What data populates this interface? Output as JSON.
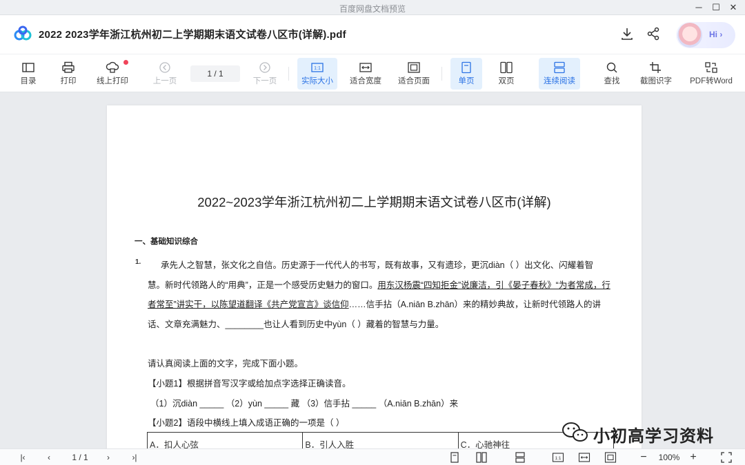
{
  "window": {
    "title": "百度网盘文档预览"
  },
  "header": {
    "doc_title": "2022  2023学年浙江杭州初二上学期期末语文试卷八区市(详解).pdf",
    "avatar_text": "Hi ›"
  },
  "toolbar": {
    "toc": "目录",
    "print": "打印",
    "online_print": "线上打印",
    "prev": "上一页",
    "page_indicator": "1  /  1",
    "next": "下一页",
    "actual_size": "实际大小",
    "fit_width": "适合宽度",
    "fit_page": "适合页面",
    "single": "单页",
    "double": "双页",
    "continuous": "连续阅读",
    "find": "查找",
    "ocr": "截图识字",
    "pdf2word": "PDF转Word"
  },
  "document": {
    "title": "2022~2023学年浙江杭州初二上学期期末语文试卷八区市(详解)",
    "section1": "一、基础知识综合",
    "q_number": "1.",
    "p1": "承先人之智慧，张文化之自信。历史源于一代代人的书写，既有故事，又有遗珍，更沉diàn（    ）出文化、闪耀着智",
    "p2_a": "慧。新时代领路人的“用典”，正是一个感受历史魅力的窗口。",
    "p2_b": "用东汉杨震“四知拒金”说廉洁，引《晏子春秋》“为者常成，行",
    "p3_a": "者常至”讲实干，以陈望道翻译《共产党宣言》谈信仰",
    "p3_b": "……信手拈（A.niān B.zhān）来的精妙典故，让新时代领路人的讲",
    "p4": "话、文章充满魅力、________也让人看到历史中yùn（    ）藏着的智慧与力量。",
    "instr": "请认真阅读上面的文字，完成下面小题。",
    "sub1": "【小题1】根据拼音写汉字或给加点字选择正确读音。",
    "sub1_line": "（1）沉diàn _____        （2）yùn _____ 藏        （3）信手拈 _____    （A.niān     B.zhān）来",
    "sub2": "【小题2】语段中横线上填入成语正确的一项是（     ）",
    "options": [
      "A．扣人心弦",
      "B．引人入胜",
      "C．心驰神往"
    ],
    "watermark": "小初高学习资料"
  },
  "statusbar": {
    "page": "1  /  1",
    "zoom": "100%"
  }
}
